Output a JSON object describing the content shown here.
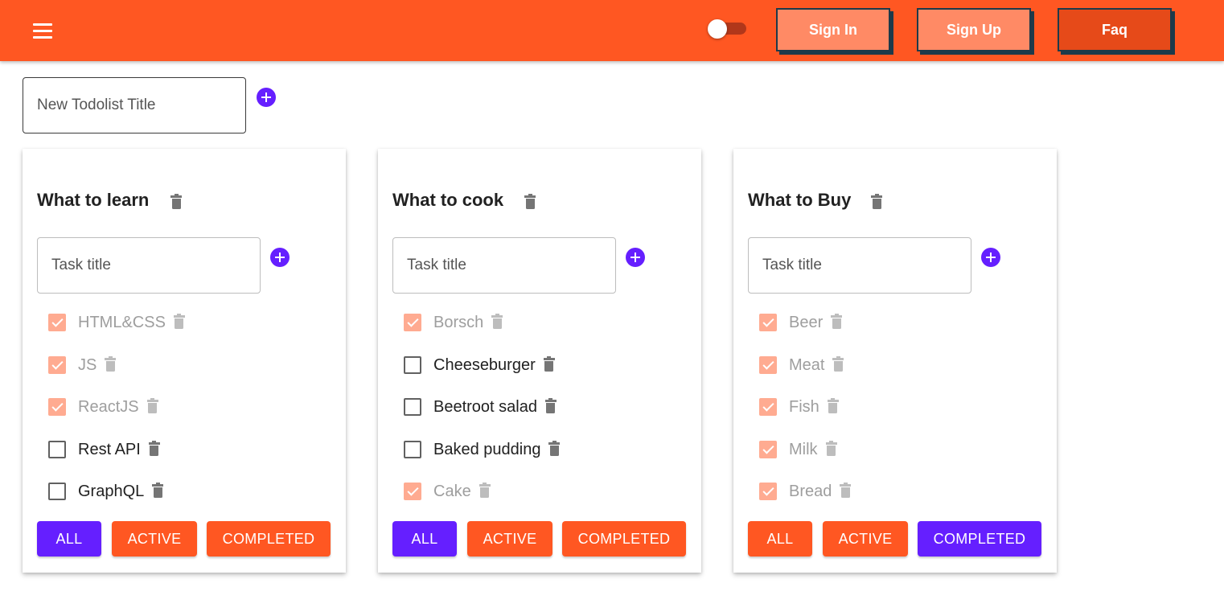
{
  "header": {
    "sign_in": "Sign In",
    "sign_up": "Sign Up",
    "faq": "Faq",
    "theme_toggle_on": false
  },
  "new_list": {
    "placeholder": "New Todolist Title"
  },
  "colors": {
    "appbar": "#ff5722",
    "primary": "#651fff",
    "secondary": "#ff5722",
    "checked": "#ffab91"
  },
  "todolists": [
    {
      "title": "What to learn",
      "task_placeholder": "Task title",
      "tasks": [
        {
          "label": "HTML&CSS",
          "done": true
        },
        {
          "label": "JS",
          "done": true
        },
        {
          "label": "ReactJS",
          "done": true
        },
        {
          "label": "Rest API",
          "done": false
        },
        {
          "label": "GraphQL",
          "done": false
        }
      ],
      "filters": {
        "all": "ALL",
        "active": "ACTIVE",
        "completed": "COMPLETED"
      },
      "active_filter": "all"
    },
    {
      "title": "What to cook",
      "task_placeholder": "Task title",
      "tasks": [
        {
          "label": "Borsch",
          "done": true
        },
        {
          "label": "Cheeseburger",
          "done": false
        },
        {
          "label": "Beetroot salad",
          "done": false
        },
        {
          "label": "Baked pudding",
          "done": false
        },
        {
          "label": "Cake",
          "done": true
        }
      ],
      "filters": {
        "all": "ALL",
        "active": "ACTIVE",
        "completed": "COMPLETED"
      },
      "active_filter": "all"
    },
    {
      "title": "What to Buy",
      "task_placeholder": "Task title",
      "tasks": [
        {
          "label": "Beer",
          "done": true
        },
        {
          "label": "Meat",
          "done": true
        },
        {
          "label": "Fish",
          "done": true
        },
        {
          "label": "Milk",
          "done": true
        },
        {
          "label": "Bread",
          "done": true
        }
      ],
      "filters": {
        "all": "ALL",
        "active": "ACTIVE",
        "completed": "COMPLETED"
      },
      "active_filter": "completed"
    }
  ]
}
